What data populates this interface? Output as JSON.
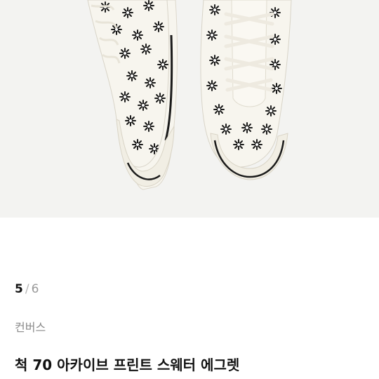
{
  "gallery": {
    "current_page": "5",
    "separator": "/",
    "total_pages": "6"
  },
  "product": {
    "brand": "컨버스",
    "title": "척 70 아카이브 프린트 스웨터 에그렛"
  },
  "colors": {
    "image_background": "#f3f3f1",
    "shoe_canvas": "#f7f5ee",
    "print": "#1b1b1b"
  },
  "icons": {
    "product_photo": "converse-sneakers-flower-print"
  }
}
